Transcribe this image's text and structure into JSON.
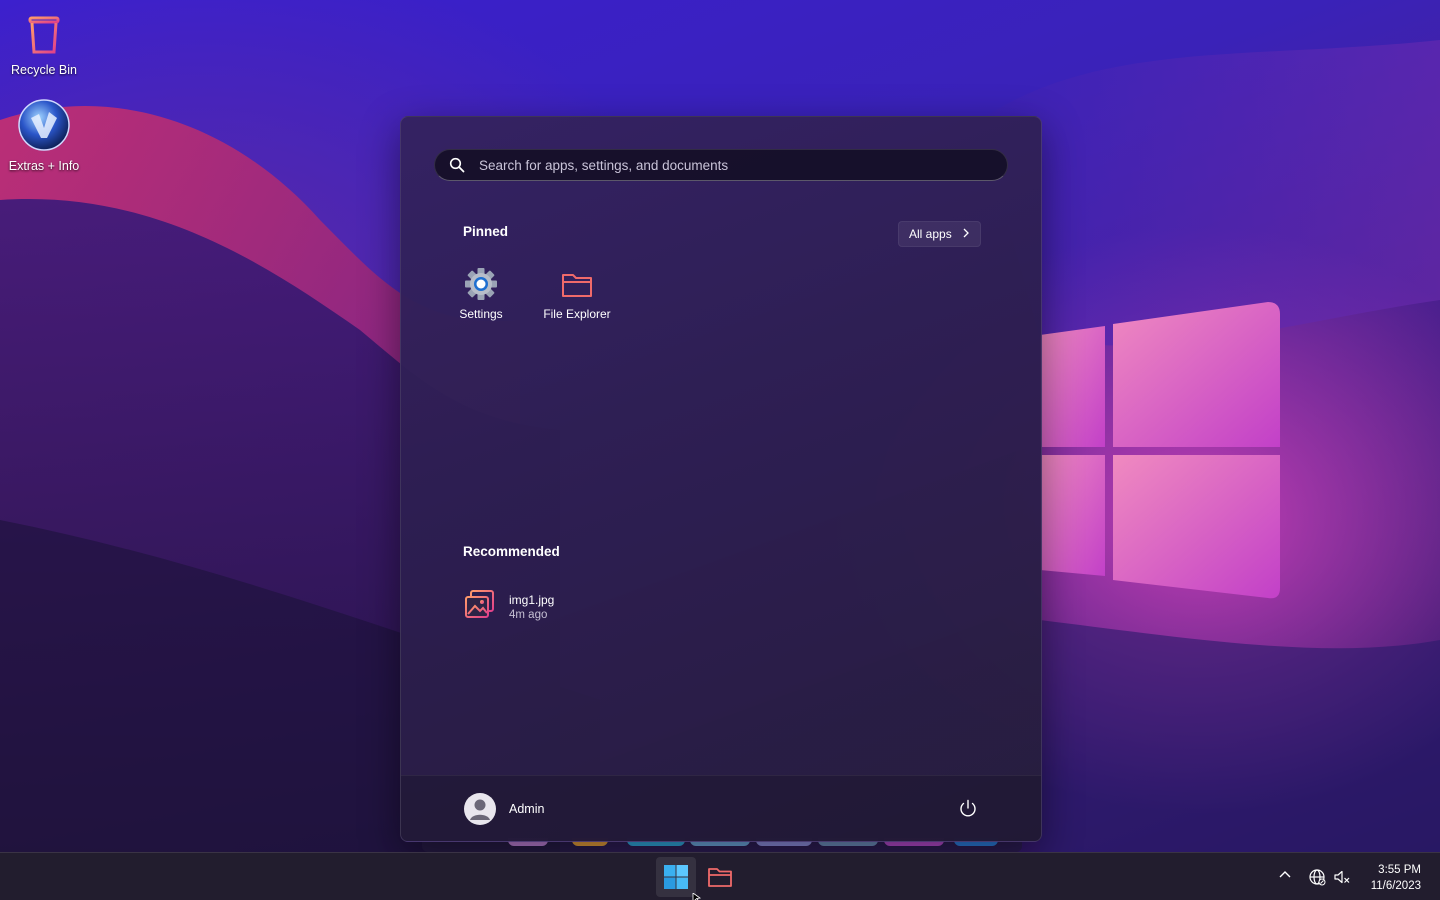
{
  "desktop": {
    "icons": [
      {
        "label": "Recycle Bin",
        "icon": "recycle-bin-icon"
      },
      {
        "label": "Extras + Info",
        "icon": "extras-info-icon"
      }
    ]
  },
  "start_menu": {
    "search": {
      "placeholder": "Search for apps, settings, and documents",
      "value": ""
    },
    "pinned": {
      "title": "Pinned",
      "all_apps_label": "All apps",
      "apps": [
        {
          "label": "Settings",
          "icon": "gear-icon"
        },
        {
          "label": "File Explorer",
          "icon": "folder-icon"
        }
      ]
    },
    "recommended": {
      "title": "Recommended",
      "items": [
        {
          "name": "img1.jpg",
          "time": "4m ago",
          "icon": "image-file-icon"
        }
      ]
    },
    "user": {
      "name": "Admin"
    }
  },
  "taskbar": {
    "apps": [
      {
        "name": "start",
        "icon": "windows-logo-icon"
      },
      {
        "name": "file-explorer",
        "icon": "folder-icon"
      }
    ],
    "clock": {
      "time": "3:55 PM",
      "date": "11/6/2023"
    }
  },
  "colors": {
    "accent": "#4cc2ff",
    "folder": "#f06a6a",
    "wallpaper_pink": "#e56cc0"
  }
}
